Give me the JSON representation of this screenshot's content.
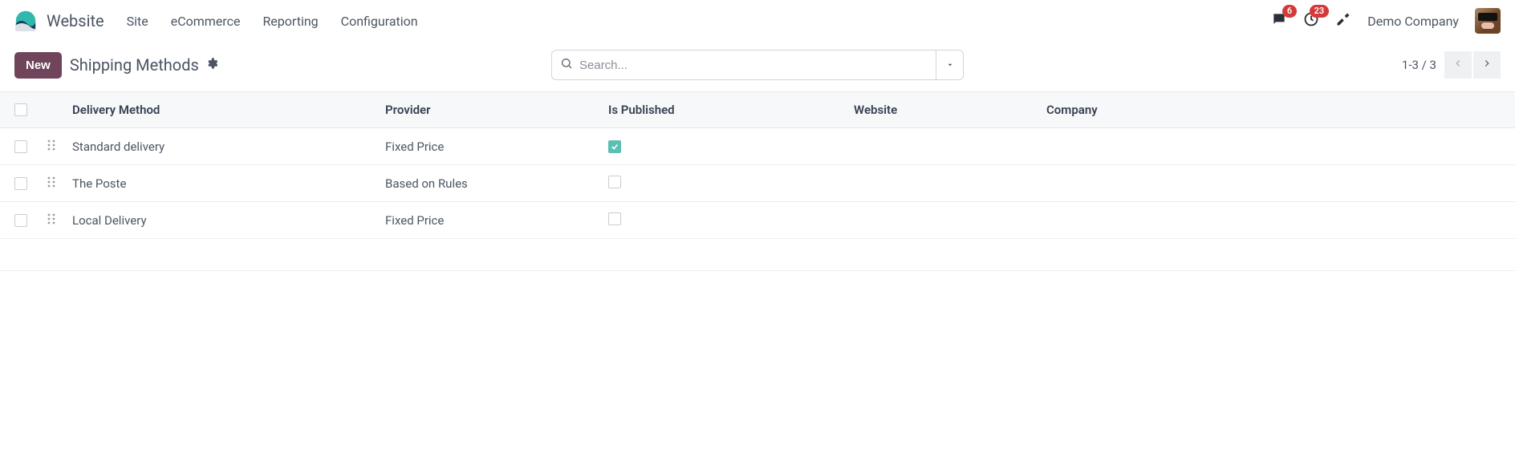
{
  "app": {
    "name": "Website"
  },
  "nav": {
    "items": [
      "Site",
      "eCommerce",
      "Reporting",
      "Configuration"
    ]
  },
  "header": {
    "messages_badge": "6",
    "activities_badge": "23",
    "company": "Demo Company"
  },
  "controls": {
    "new_label": "New",
    "breadcrumb": "Shipping Methods",
    "search_placeholder": "Search...",
    "pager_text": "1-3 / 3"
  },
  "table": {
    "headers": {
      "delivery_method": "Delivery Method",
      "provider": "Provider",
      "is_published": "Is Published",
      "website": "Website",
      "company": "Company"
    },
    "rows": [
      {
        "delivery_method": "Standard delivery",
        "provider": "Fixed Price",
        "is_published": true,
        "website": "",
        "company": ""
      },
      {
        "delivery_method": "The Poste",
        "provider": "Based on Rules",
        "is_published": false,
        "website": "",
        "company": ""
      },
      {
        "delivery_method": "Local Delivery",
        "provider": "Fixed Price",
        "is_published": false,
        "website": "",
        "company": ""
      }
    ]
  }
}
